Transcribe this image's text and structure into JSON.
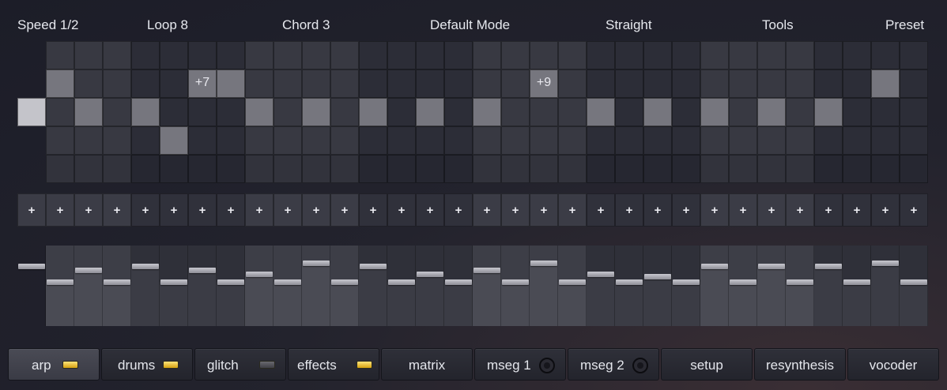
{
  "header": {
    "speed": "Speed 1/2",
    "loop": "Loop 8",
    "chord": "Chord 3",
    "mode": "Default Mode",
    "groove": "Straight",
    "tools": "Tools",
    "preset": "Preset"
  },
  "pattern": {
    "rows": 5,
    "steps": 32,
    "active_notes": [
      {
        "step": 0,
        "row": 2
      },
      {
        "step": 1,
        "row": 1
      },
      {
        "step": 2,
        "row": 2
      },
      {
        "step": 4,
        "row": 2
      },
      {
        "step": 5,
        "row": 3
      },
      {
        "step": 6,
        "row": 1,
        "offset": "+7"
      },
      {
        "step": 7,
        "row": 1
      },
      {
        "step": 8,
        "row": 2
      },
      {
        "step": 10,
        "row": 2
      },
      {
        "step": 12,
        "row": 2
      },
      {
        "step": 14,
        "row": 2
      },
      {
        "step": 16,
        "row": 2
      },
      {
        "step": 18,
        "row": 1,
        "offset": "+9"
      },
      {
        "step": 20,
        "row": 2
      },
      {
        "step": 22,
        "row": 2
      },
      {
        "step": 24,
        "row": 2
      },
      {
        "step": 26,
        "row": 2
      },
      {
        "step": 28,
        "row": 2
      },
      {
        "step": 30,
        "row": 1
      }
    ],
    "add_symbol": "+",
    "velocity": [
      0.75,
      0.55,
      0.7,
      0.55,
      0.75,
      0.55,
      0.7,
      0.55,
      0.65,
      0.55,
      0.78,
      0.55,
      0.75,
      0.55,
      0.65,
      0.55,
      0.7,
      0.55,
      0.78,
      0.55,
      0.65,
      0.55,
      0.62,
      0.55,
      0.75,
      0.55,
      0.75,
      0.55,
      0.75,
      0.55,
      0.78,
      0.55
    ]
  },
  "tabs": [
    {
      "label": "arp",
      "indicator": "led-on",
      "active": true
    },
    {
      "label": "drums",
      "indicator": "led-on",
      "active": false
    },
    {
      "label": "glitch",
      "indicator": "led-off",
      "active": false
    },
    {
      "label": "effects",
      "indicator": "led-on",
      "active": false
    },
    {
      "label": "matrix",
      "indicator": "none",
      "active": false
    },
    {
      "label": "mseg 1",
      "indicator": "ring",
      "active": false
    },
    {
      "label": "mseg 2",
      "indicator": "ring",
      "active": false
    },
    {
      "label": "setup",
      "indicator": "none",
      "active": false
    },
    {
      "label": "resynthesis",
      "indicator": "none",
      "active": false
    },
    {
      "label": "vocoder",
      "indicator": "none",
      "active": false
    }
  ],
  "colors": {
    "note_on": "#76767e",
    "first_note": "#c4c4ca",
    "led_on": "#f0c23a"
  }
}
